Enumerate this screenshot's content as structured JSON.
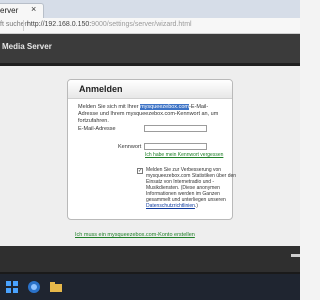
{
  "browser": {
    "tab_title": "erver",
    "tab_close": "×",
    "search_partial": "ft suchen",
    "url_host": "http://192.168.0.150:",
    "url_path": "9000/settings/server/wizard.html"
  },
  "app": {
    "title": "Media Server"
  },
  "login": {
    "heading": "Anmelden",
    "intro_before": "Melden Sie sich mit Ihrer ",
    "intro_site": "mysqueezebox.com",
    "intro_after": "-E-Mail-Adresse und Ihrem mysqueezebox.com-Kennwort an, um fortzufahren.",
    "email_label": "E-Mail-Adresse",
    "email_value": "",
    "password_label": "Kennwort",
    "password_value": "",
    "forgot_link": "Ich habe mein Kennwort vergessen",
    "consent_checked": true,
    "consent_mark": "✓",
    "consent_text": "Melden Sie zur Verbesserung von mysqueezebox.com Statistiken über den Einsatz von Internetradio und -Musikdiensten. (Diese anonymen Informationen werden im Ganzen gesammelt und unterliegen unseren ",
    "consent_link": "Datenschutzrichtlinien",
    "consent_end": ".)",
    "create_account_link": "Ich muss ein mysqueezebox.com-Konto erstellen"
  },
  "colors": {
    "header_bg": "#3b3b3b",
    "link_green": "#1d7f26",
    "highlight_blue": "#3d73c6"
  }
}
